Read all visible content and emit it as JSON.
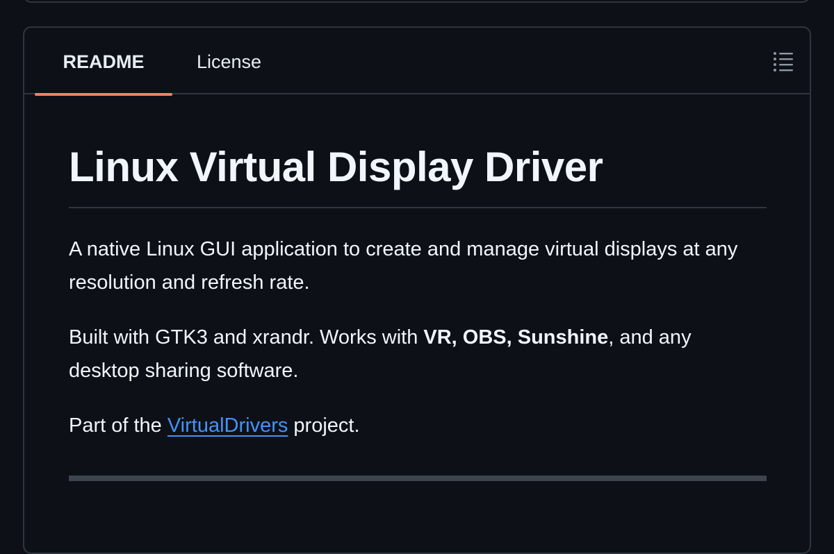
{
  "tabs": {
    "readme": "README",
    "license": "License",
    "outline_icon": "list-outline-icon"
  },
  "readme": {
    "title": "Linux Virtual Display Driver",
    "intro": "A native Linux GUI application to create and manage virtual displays at any resolution and refresh rate.",
    "built_prefix": "Built with GTK3 and xrandr. Works with ",
    "built_bold": "VR, OBS, Sunshine",
    "built_suffix": ", and any desktop sharing software.",
    "part_prefix": "Part of the ",
    "part_link": "VirtualDrivers",
    "part_suffix": " project."
  },
  "colors": {
    "background": "#0d1117",
    "border": "#30363d",
    "active_tab_underline": "#f78166",
    "link": "#4493f8"
  }
}
